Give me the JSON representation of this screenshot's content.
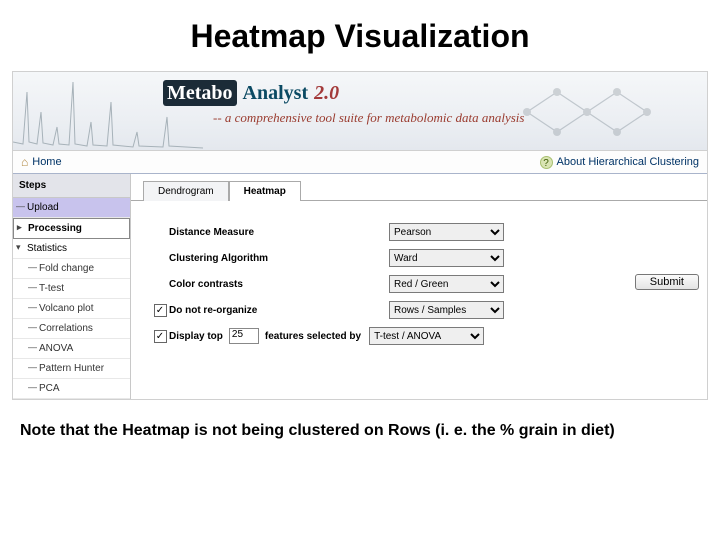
{
  "slide": {
    "title": "Heatmap Visualization"
  },
  "banner": {
    "logo_metabo": "Metabo",
    "logo_analyst": "Analyst",
    "version": "2.0",
    "tagline": "-- a comprehensive tool suite for metabolomic data analysis"
  },
  "nav": {
    "home": "Home",
    "right": "About Hierarchical Clustering"
  },
  "sidebar": {
    "head": "Steps",
    "items": [
      {
        "mark": "—",
        "label": "Upload",
        "cls": "purple"
      },
      {
        "mark": "▸",
        "label": "Processing",
        "cls": "bold"
      },
      {
        "mark": "▾",
        "label": "Statistics",
        "cls": ""
      }
    ],
    "subs": [
      {
        "mark": "—",
        "label": "Fold change"
      },
      {
        "mark": "—",
        "label": "T-test"
      },
      {
        "mark": "—",
        "label": "Volcano plot"
      },
      {
        "mark": "—",
        "label": "Correlations"
      },
      {
        "mark": "—",
        "label": "ANOVA"
      },
      {
        "mark": "—",
        "label": "Pattern Hunter"
      },
      {
        "mark": "—",
        "label": "PCA"
      }
    ]
  },
  "tabs": {
    "dendrogram": "Dendrogram",
    "heatmap": "Heatmap"
  },
  "form": {
    "distance_lbl": "Distance Measure",
    "distance_val": "Pearson",
    "cluster_lbl": "Clustering Algorithm",
    "cluster_val": "Ward",
    "color_lbl": "Color contrasts",
    "color_val": "Red / Green",
    "reorg_lbl": "Do not re-organize",
    "reorg_val": "Rows / Samples",
    "display_lbl_pre": "Display top",
    "display_num": "25",
    "display_lbl_post": "features selected by",
    "display_val": "T-test / ANOVA",
    "submit": "Submit"
  },
  "footnote": "Note that the Heatmap is not being clustered on Rows (i. e. the % grain in diet)"
}
